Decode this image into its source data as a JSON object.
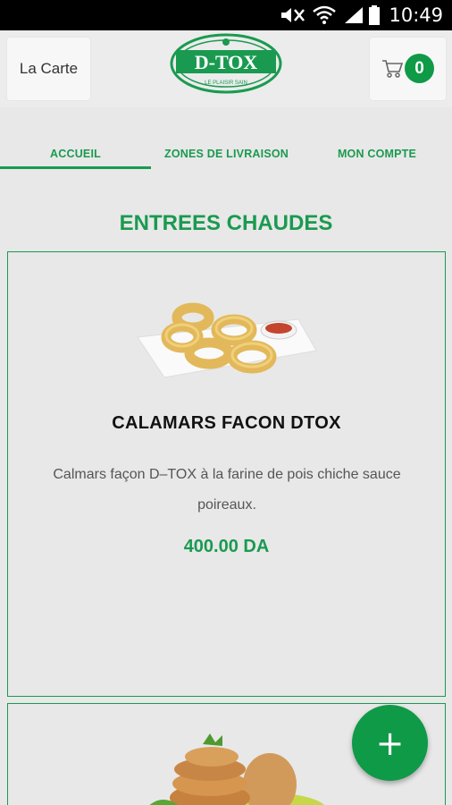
{
  "status_bar": {
    "time": "10:49"
  },
  "header": {
    "menu_label": "La Carte",
    "logo_text": "D-TOX",
    "logo_sub": "LE PLAISIR SAIN",
    "cart_count": "0"
  },
  "tabs": [
    {
      "label": "ACCUEIL",
      "active": true
    },
    {
      "label": "ZONES DE LIVRAISON",
      "active": false
    },
    {
      "label": "MON COMPTE",
      "active": false
    }
  ],
  "section": {
    "title": "ENTREES CHAUDES"
  },
  "products": [
    {
      "name": "CALAMARS FACON DTOX",
      "description": "Calmars façon D–TOX à la farine de pois chiche sauce poireaux.",
      "price": "400.00 DA"
    }
  ],
  "fab_label": "+",
  "colors": {
    "accent": "#1a9a50",
    "badge": "#0e9a47",
    "background": "#e8e8e8"
  }
}
